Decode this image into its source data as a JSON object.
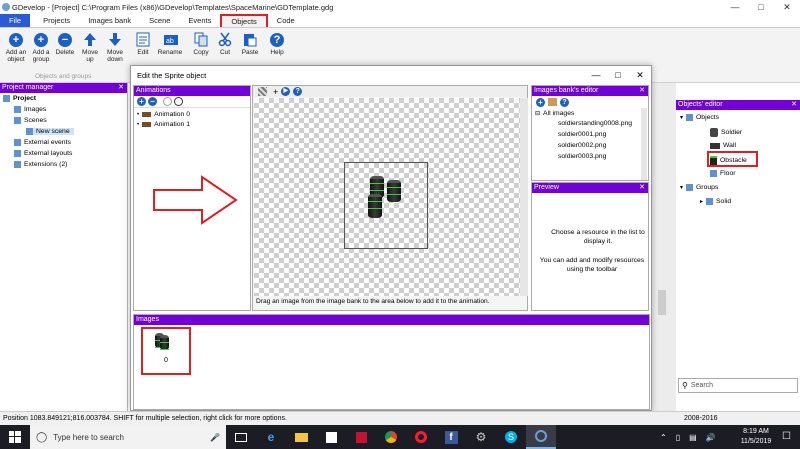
{
  "window": {
    "title": "GDevelop - [Project] C:\\Program Files (x86)\\GDevelop\\Templates\\SpaceMarine\\GDTemplate.gdg"
  },
  "menu": [
    "File",
    "Projects",
    "Images bank",
    "Scene",
    "Events",
    "Objects",
    "Code"
  ],
  "ribbon": {
    "buttons": [
      {
        "label": "Add an object"
      },
      {
        "label": "Add a group"
      },
      {
        "label": "Delete"
      },
      {
        "label": "Move up"
      },
      {
        "label": "Move down"
      },
      {
        "label": "Edit"
      },
      {
        "label": "Rename"
      },
      {
        "label": "Copy"
      },
      {
        "label": "Cut"
      },
      {
        "label": "Paste"
      },
      {
        "label": "Help"
      }
    ],
    "group_caption": "Objects and groups"
  },
  "project_manager": {
    "title": "Project manager",
    "items": [
      "Project",
      "Images",
      "Scenes",
      "New scene",
      "External events",
      "External layouts",
      "Extensions (2)"
    ]
  },
  "dialog": {
    "title": "Edit the Sprite object",
    "animations_title": "Animations",
    "animations": [
      "Animation 0",
      "Animation 1"
    ],
    "hint": "Drag an image from the image bank to the area below to add it to the animation.",
    "images_title": "Images",
    "image_index": "0",
    "bank_title": "Images bank's editor",
    "bank_root": "All images",
    "bank_items": [
      "soldierstanding0008.png",
      "soldier0001.png",
      "soldier0002.png",
      "soldier0003.png"
    ],
    "preview_title": "Preview",
    "preview_text1": "Choose a resource in the list to display it.",
    "preview_text2": "You can add and modify resources using the toolbar"
  },
  "objects_editor": {
    "title": "Objects' editor",
    "objects_root": "Objects",
    "objects": [
      "Soldier",
      "Wall",
      "Obstacle",
      "Floor"
    ],
    "groups_root": "Groups",
    "groups": [
      "Solid"
    ],
    "search_placeholder": "Search"
  },
  "status": {
    "text": "Position 1083.849121;816.003784. SHIFT for multiple selection, right click for more options.",
    "right": "2008-2016"
  },
  "taskbar": {
    "search_placeholder": "Type here to search",
    "time": "8:19 AM",
    "date": "11/5/2019"
  }
}
